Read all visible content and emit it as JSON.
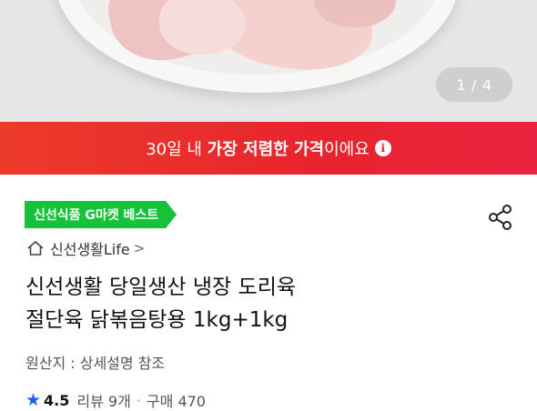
{
  "gallery": {
    "current": "1",
    "separator": "/",
    "total": "4"
  },
  "price_banner": {
    "prefix": "30일 내 ",
    "highlight": "가장 저렴한 가격",
    "suffix": "이에요",
    "info_icon": "i"
  },
  "badge": {
    "label": "신선식품 G마켓 베스트",
    "color": "#15c23a"
  },
  "share_icon": "share-icon",
  "store": {
    "icon": "home-icon",
    "name": "신선생활Life",
    "chevron": ">"
  },
  "product": {
    "title_line1": "신선생활 당일생산 냉장 도리육",
    "title_line2": "절단육 닭볶음탕용 1kg+1kg",
    "origin": "원산지 : 상세설명 참조"
  },
  "rating": {
    "star": "★",
    "score": "4.5",
    "reviews": "리뷰 9개",
    "separator": "·",
    "purchases": "구매 470",
    "star_color": "#1e5ff2"
  },
  "colors": {
    "banner_red": "#e8242e"
  }
}
